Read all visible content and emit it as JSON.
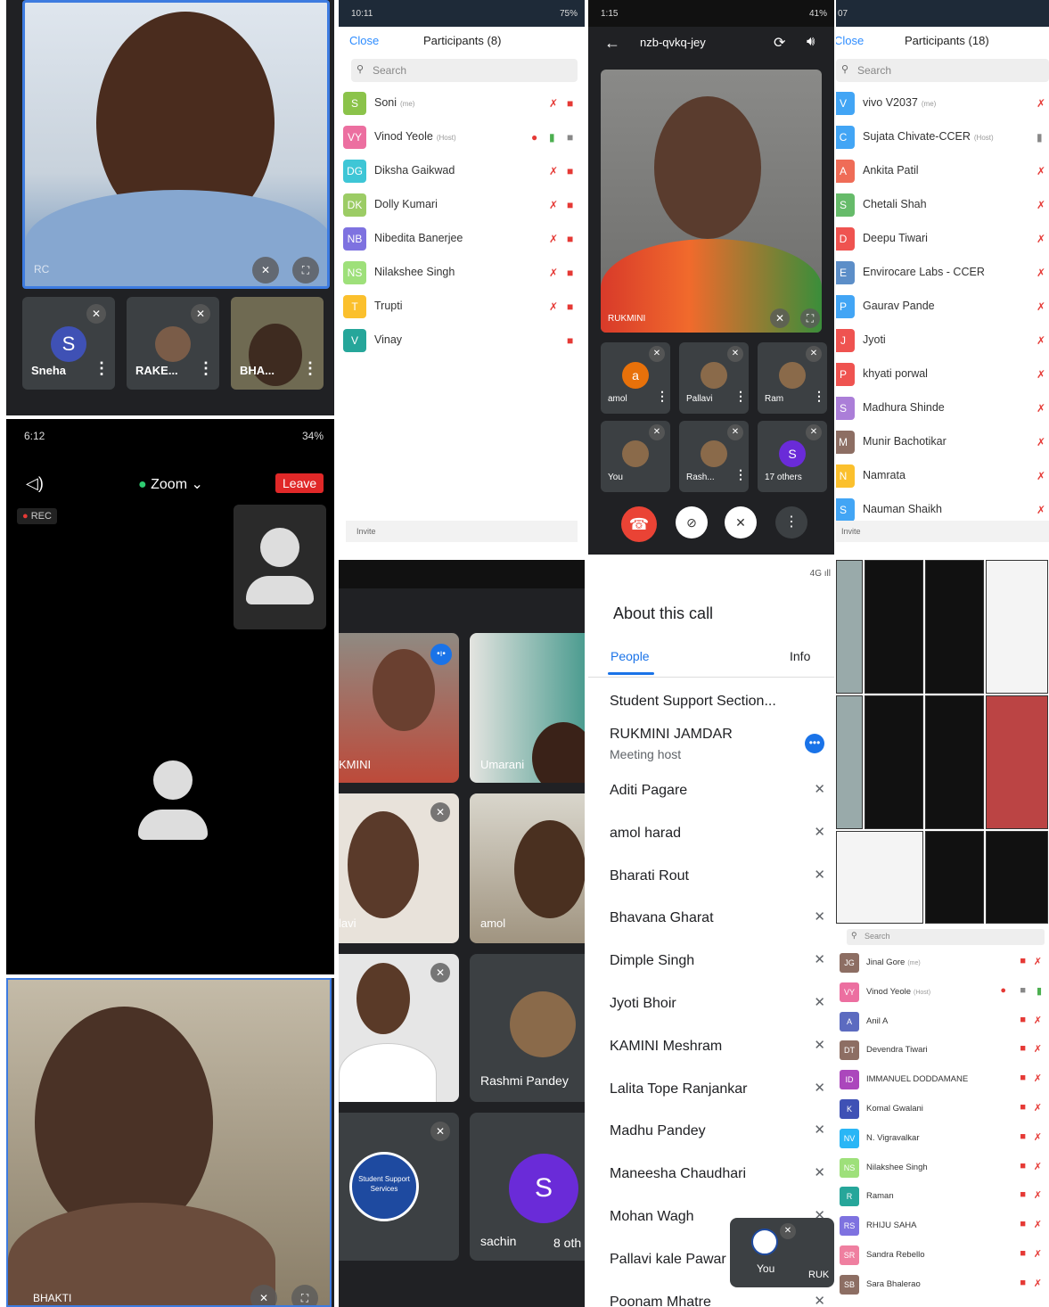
{
  "p1": {
    "name_main": "RC",
    "tiles": [
      "Sneha",
      "RAKE...",
      "BHA..."
    ],
    "avatar_letter": "S"
  },
  "p2": {
    "time": "10:11",
    "battery": "75%",
    "close": "Close",
    "title": "Participants (8)",
    "search": "Search",
    "invite": "Invite",
    "participants": [
      {
        "initials": "S",
        "name": "Soni",
        "tag": "(me)",
        "color": "#8bc34a"
      },
      {
        "initials": "VY",
        "name": "Vinod Yeole",
        "tag": "(Host)",
        "color": "#ec6fa0"
      },
      {
        "initials": "DG",
        "name": "Diksha Gaikwad",
        "tag": "",
        "color": "#3ec6d6"
      },
      {
        "initials": "DK",
        "name": "Dolly Kumari",
        "tag": "",
        "color": "#9ccc65"
      },
      {
        "initials": "NB",
        "name": "Nibedita Banerjee",
        "tag": "",
        "color": "#7e72e0"
      },
      {
        "initials": "NS",
        "name": "Nilakshee Singh",
        "tag": "",
        "color": "#9ee07a"
      },
      {
        "initials": "T",
        "name": "Trupti",
        "tag": "",
        "color": "#fbc02d"
      },
      {
        "initials": "V",
        "name": "Vinay",
        "tag": "",
        "color": "#26a69a"
      }
    ]
  },
  "p3": {
    "time": "1:15",
    "meeting": "nzb-qvkq-jey",
    "main_name": "RUKMINI",
    "tiles": [
      {
        "name": "amol",
        "letter": "a"
      },
      {
        "name": "Pallavi"
      },
      {
        "name": "Ram"
      },
      {
        "name": "You"
      },
      {
        "name": "Rash..."
      },
      {
        "name": "17 others",
        "letter": "S"
      }
    ]
  },
  "p4": {
    "time": "07",
    "close": "Close",
    "title": "Participants (18)",
    "search": "Search",
    "invite": "Invite",
    "participants": [
      {
        "initials": "V",
        "name": "vivo V2037",
        "tag": "(me)",
        "color": "#42a5f5"
      },
      {
        "initials": "C",
        "name": "Sujata Chivate-CCER",
        "tag": "(Host)",
        "color": "#42a5f5"
      },
      {
        "initials": "A",
        "name": "Ankita Patil",
        "tag": "",
        "color": "#ef6c57"
      },
      {
        "initials": "S",
        "name": "Chetali Shah",
        "tag": "",
        "color": "#66bb6a"
      },
      {
        "initials": "D",
        "name": "Deepu Tiwari",
        "tag": "",
        "color": "#ef5350"
      },
      {
        "initials": "E",
        "name": "Envirocare Labs - CCER",
        "tag": "",
        "color": "#5c8ec8"
      },
      {
        "initials": "P",
        "name": "Gaurav Pande",
        "tag": "",
        "color": "#42a5f5"
      },
      {
        "initials": "J",
        "name": "Jyoti",
        "tag": "",
        "color": "#ef5350"
      },
      {
        "initials": "P",
        "name": "khyati porwal",
        "tag": "",
        "color": "#ef5350"
      },
      {
        "initials": "S",
        "name": "Madhura Shinde",
        "tag": "",
        "color": "#ab7ed8"
      },
      {
        "initials": "M",
        "name": "Munir Bachotikar",
        "tag": "",
        "color": "#8d6e63"
      },
      {
        "initials": "N",
        "name": "Namrata",
        "tag": "",
        "color": "#fbc02d"
      },
      {
        "initials": "S",
        "name": "Nauman Shaikh",
        "tag": "",
        "color": "#42a5f5"
      }
    ]
  },
  "p5": {
    "time": "6:12",
    "battery": "34%",
    "app": "Zoom",
    "leave": "Leave",
    "rec": "REC"
  },
  "p6": {
    "tiles": [
      "KMINI",
      "Umarani",
      "lavi",
      "amol",
      "Rashmi Pandey",
      "sachin",
      "8 oth"
    ],
    "sachin_letter": "S",
    "logo_text": "Student Support Services"
  },
  "p7": {
    "title": "About this call",
    "tab_people": "People",
    "tab_info": "Info",
    "group": "Student Support Section...",
    "host": {
      "name": "RUKMINI JAMDAR",
      "role": "Meeting host"
    },
    "people": [
      "Aditi Pagare",
      "amol harad",
      "Bharati Rout",
      "Bhavana Gharat",
      "Dimple Singh",
      "Jyoti Bhoir",
      "KAMINI Meshram",
      "Lalita Tope Ranjankar",
      "Madhu Pandey",
      "Maneesha Chaudhari",
      "Mohan Wagh",
      "Pallavi kale Pawar",
      "Poonam Mhatre"
    ],
    "you": "You",
    "ruk": "RUK"
  },
  "p8": {
    "search": "Search",
    "participants": [
      {
        "initials": "JG",
        "name": "Jinal Gore",
        "tag": "(me)",
        "color": "#8d6e63"
      },
      {
        "initials": "VY",
        "name": "Vinod Yeole",
        "tag": "(Host)",
        "color": "#ec6fa0"
      },
      {
        "initials": "A",
        "name": "Anil A",
        "tag": "",
        "color": "#5c6bc0"
      },
      {
        "initials": "DT",
        "name": "Devendra Tiwari",
        "tag": "",
        "color": "#8d6e63"
      },
      {
        "initials": "ID",
        "name": "IMMANUEL DODDAMANE",
        "tag": "",
        "color": "#ab47bc"
      },
      {
        "initials": "K",
        "name": "Komal Gwalani",
        "tag": "",
        "color": "#3f51b5"
      },
      {
        "initials": "NV",
        "name": "N. Vigravalkar",
        "tag": "",
        "color": "#29b6f6"
      },
      {
        "initials": "NS",
        "name": "Nilakshee Singh",
        "tag": "",
        "color": "#9ee07a"
      },
      {
        "initials": "R",
        "name": "Raman",
        "tag": "",
        "color": "#26a69a"
      },
      {
        "initials": "RS",
        "name": "RHIJU SAHA",
        "tag": "",
        "color": "#7e72e0"
      },
      {
        "initials": "SR",
        "name": "Sandra Rebello",
        "tag": "",
        "color": "#ef7fa0"
      },
      {
        "initials": "SB",
        "name": "Sara Bhalerao",
        "tag": "",
        "color": "#8d6e63"
      }
    ]
  },
  "p9": {
    "name": "BHAKTI"
  }
}
